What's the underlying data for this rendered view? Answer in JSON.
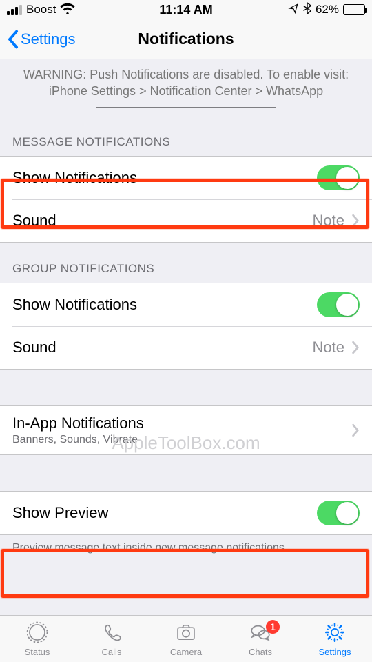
{
  "status": {
    "carrier": "Boost",
    "time": "11:14 AM",
    "battery_pct": "62%"
  },
  "nav": {
    "back": "Settings",
    "title": "Notifications"
  },
  "warning": {
    "line1": "WARNING: Push Notifications are disabled. To enable visit:",
    "line2": "iPhone Settings > Notification Center > WhatsApp"
  },
  "sections": {
    "message": {
      "header": "MESSAGE NOTIFICATIONS",
      "show_label": "Show Notifications",
      "sound_label": "Sound",
      "sound_value": "Note"
    },
    "group": {
      "header": "GROUP NOTIFICATIONS",
      "show_label": "Show Notifications",
      "sound_label": "Sound",
      "sound_value": "Note"
    },
    "inapp": {
      "label": "In-App Notifications",
      "sub": "Banners, Sounds, Vibrate"
    },
    "preview": {
      "label": "Show Preview",
      "footer": "Preview message text inside new message notifications."
    }
  },
  "watermark": "AppleToolBox.com",
  "tabs": {
    "status": "Status",
    "calls": "Calls",
    "camera": "Camera",
    "chats": "Chats",
    "settings": "Settings",
    "chats_badge": "1"
  }
}
